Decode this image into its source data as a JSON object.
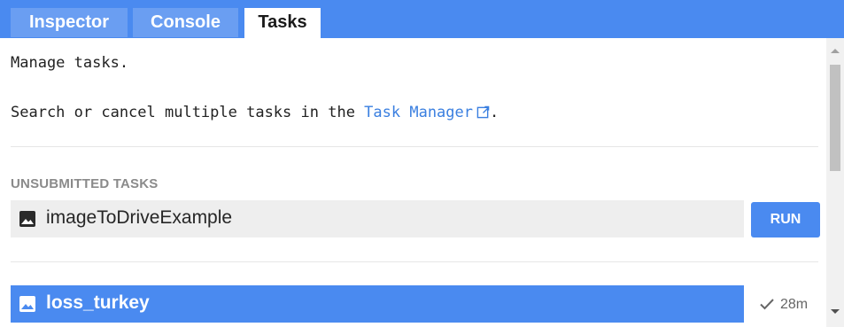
{
  "tabs": [
    {
      "label": "Inspector",
      "active": false
    },
    {
      "label": "Console",
      "active": false
    },
    {
      "label": "Tasks",
      "active": true
    }
  ],
  "intro_text": "Manage tasks.",
  "search_text_before": "Search or cancel multiple tasks in the ",
  "task_manager_link": "Task Manager",
  "search_text_after": ".",
  "unsubmitted": {
    "section_title": "UNSUBMITTED TASKS",
    "tasks": [
      {
        "name": "imageToDriveExample",
        "icon": "image-icon",
        "button_label": "RUN"
      }
    ]
  },
  "completed": {
    "tasks": [
      {
        "name": "loss_turkey",
        "icon": "image-icon",
        "status_icon": "check-icon",
        "duration": "28m"
      }
    ]
  },
  "colors": {
    "accent": "#4a8af0",
    "link": "#3a7fe0",
    "row_background": "#eeeeee"
  }
}
